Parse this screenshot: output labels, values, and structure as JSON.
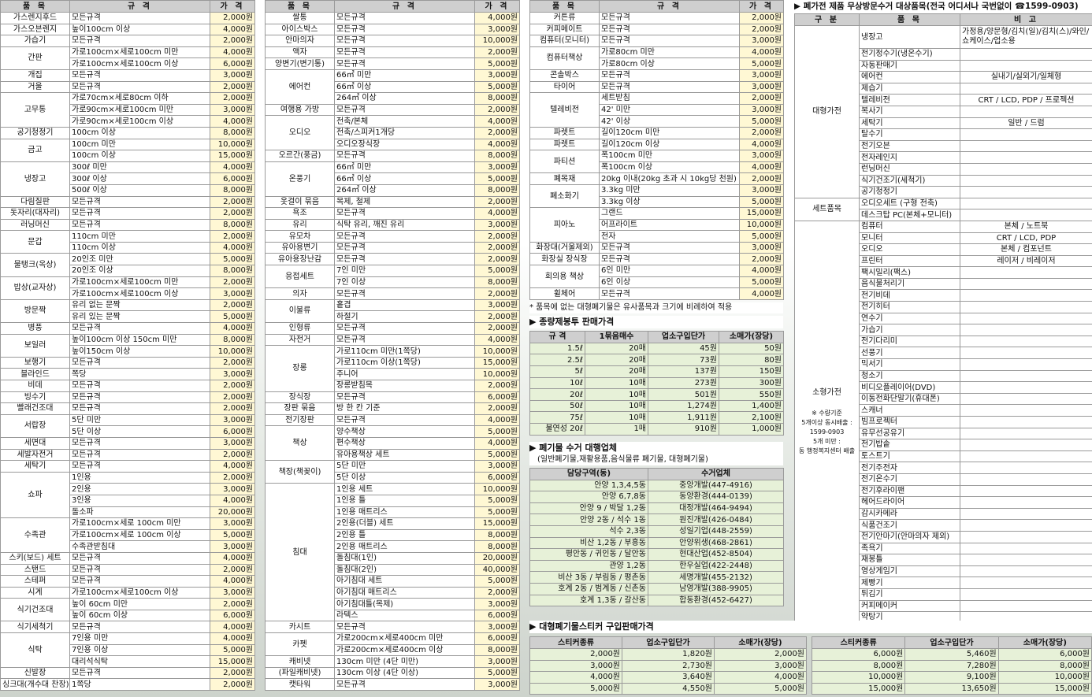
{
  "col1": {
    "headers": [
      "품 목",
      "규 격",
      "가 격"
    ],
    "rows": [
      [
        "가스렌지후드",
        "모든규격",
        "2,000원"
      ],
      [
        "가스오븐렌지",
        "높이100cm 이상",
        "4,000원"
      ],
      [
        "가습기",
        "모든규격",
        "2,000원"
      ],
      [
        "간판",
        "가로100cm×세로100cm 미만",
        "4,000원"
      ],
      [
        "",
        "가로100cm×세로100cm 이상",
        "6,000원"
      ],
      [
        "개집",
        "모든규격",
        "3,000원"
      ],
      [
        "거울",
        "모든규격",
        "2,000원"
      ],
      [
        "고무통",
        "가로70cm×세로80cm 이하",
        "2,000원"
      ],
      [
        "",
        "가로90cm×세로100cm 미만",
        "3,000원"
      ],
      [
        "",
        "가로90cm×세로100cm 이상",
        "4,000원"
      ],
      [
        "공기청정기",
        "100cm 이상",
        "8,000원"
      ],
      [
        "금고",
        "100cm 미만",
        "10,000원"
      ],
      [
        "",
        "100cm 이상",
        "15,000원"
      ],
      [
        "냉장고",
        "300ℓ 미만",
        "4,000원"
      ],
      [
        "",
        "300ℓ 이상",
        "6,000원"
      ],
      [
        "",
        "500ℓ 이상",
        "8,000원"
      ],
      [
        "다림질판",
        "모든규격",
        "2,000원"
      ],
      [
        "돗자리(대자리)",
        "모든규격",
        "2,000원"
      ],
      [
        "러닝머신",
        "모든규격",
        "8,000원"
      ],
      [
        "문갑",
        "110cm 미만",
        "2,000원"
      ],
      [
        "",
        "110cm 이상",
        "4,000원"
      ],
      [
        "물탱크(옥상)",
        "20인조 미만",
        "5,000원"
      ],
      [
        "",
        "20인조 이상",
        "8,000원"
      ],
      [
        "밥상(교자상)",
        "가로100cm×세로100cm 미만",
        "2,000원"
      ],
      [
        "",
        "가로100cm×세로100cm 이상",
        "3,000원"
      ],
      [
        "방문짝",
        "유리 없는 문짝",
        "2,000원"
      ],
      [
        "",
        "유리 있는 문짝",
        "5,000원"
      ],
      [
        "병풍",
        "모든규격",
        "4,000원"
      ],
      [
        "보일러",
        "높이100cm 이상 150cm 미만",
        "8,000원"
      ],
      [
        "",
        "높이150cm 이상",
        "10,000원"
      ],
      [
        "보행기",
        "모든규격",
        "2,000원"
      ],
      [
        "블라인드",
        "쪽당",
        "3,000원"
      ],
      [
        "비데",
        "모든규격",
        "2,000원"
      ],
      [
        "빙수기",
        "모든규격",
        "2,000원"
      ],
      [
        "빨래건조대",
        "모든규격",
        "2,000원"
      ],
      [
        "서랍장",
        "5단 미만",
        "3,000원"
      ],
      [
        "",
        "5단 이상",
        "6,000원"
      ],
      [
        "세면대",
        "모든규격",
        "3,000원"
      ],
      [
        "세발자전거",
        "모든규격",
        "2,000원"
      ],
      [
        "세탁기",
        "모든규격",
        "4,000원"
      ],
      [
        "쇼파",
        "1인용",
        "2,000원"
      ],
      [
        "",
        "2인용",
        "3,000원"
      ],
      [
        "",
        "3인용",
        "4,000원"
      ],
      [
        "",
        "돌소파",
        "20,000원"
      ],
      [
        "수족관",
        "가로100cm×세로 100cm 미만",
        "3,000원"
      ],
      [
        "",
        "가로100cm×세로 100cm 이상",
        "5,000원"
      ],
      [
        "",
        "수족관받침대",
        "3,000원"
      ],
      [
        "스키(보드) 세트",
        "모든규격",
        "4,000원"
      ],
      [
        "스탠드",
        "모든규격",
        "2,000원"
      ],
      [
        "스테퍼",
        "모든규격",
        "4,000원"
      ],
      [
        "시계",
        "가로100cm×세로100cm 이상",
        "3,000원"
      ],
      [
        "식기건조대",
        "높이 60cm 미만",
        "2,000원"
      ],
      [
        "",
        "높이 60cm 이상",
        "6,000원"
      ],
      [
        "식기세척기",
        "모든규격",
        "4,000원"
      ],
      [
        "식탁",
        "7인용 미만",
        "4,000원"
      ],
      [
        "",
        "7인용 이상",
        "5,000원"
      ],
      [
        "",
        "대리석식탁",
        "15,000원"
      ],
      [
        "신발장",
        "모든규격",
        "2,000원"
      ],
      [
        "싱크대(개수대 찬장)",
        "1쪽당",
        "2,000원"
      ]
    ]
  },
  "col2": {
    "headers": [
      "품 목",
      "규 격",
      "가 격"
    ],
    "rows": [
      [
        "쌀통",
        "모든규격",
        "4,000원"
      ],
      [
        "아이스박스",
        "모든규격",
        "3,000원"
      ],
      [
        "안마의자",
        "모든규격",
        "10,000원"
      ],
      [
        "액자",
        "모든규격",
        "2,000원"
      ],
      [
        "양변기(변기통)",
        "모든규격",
        "5,000원"
      ],
      [
        "에어컨",
        "66㎡ 미만",
        "3,000원"
      ],
      [
        "",
        "66㎡ 이상",
        "5,000원"
      ],
      [
        "",
        "264㎡ 이상",
        "8,000원"
      ],
      [
        "여행용 가방",
        "모든규격",
        "2,000원"
      ],
      [
        "오디오",
        "전축/본체",
        "4,000원"
      ],
      [
        "",
        "전축/스피커1개당",
        "2,000원"
      ],
      [
        "",
        "오디오장식장",
        "4,000원"
      ],
      [
        "오르간(풍금)",
        "모든규격",
        "8,000원"
      ],
      [
        "온풍기",
        "66㎡ 미만",
        "3,000원"
      ],
      [
        "",
        "66㎡ 이상",
        "5,000원"
      ],
      [
        "",
        "264㎡ 이상",
        "8,000원"
      ],
      [
        "옷걸이 묶음",
        "목제, 철제",
        "2,000원"
      ],
      [
        "욕조",
        "모든규격",
        "4,000원"
      ],
      [
        "유리",
        "식탁 유리, 깨진 유리",
        "3,000원"
      ],
      [
        "유모차",
        "모든규격",
        "2,000원"
      ],
      [
        "유아용변기",
        "모든규격",
        "2,000원"
      ],
      [
        "유아용장난감",
        "모든규격",
        "2,000원"
      ],
      [
        "응접세트",
        "7인 미만",
        "5,000원"
      ],
      [
        "",
        "7인 이상",
        "8,000원"
      ],
      [
        "의자",
        "모든규격",
        "2,000원"
      ],
      [
        "이불류",
        "홑겹",
        "3,000원"
      ],
      [
        "",
        "하절기",
        "2,000원"
      ],
      [
        "인형류",
        "모든규격",
        "2,000원"
      ],
      [
        "자전거",
        "모든규격",
        "4,000원"
      ],
      [
        "장롱",
        "가로110cm 미만(1쪽당)",
        "10,000원"
      ],
      [
        "",
        "가로110cm 이상(1쪽당)",
        "15,000원"
      ],
      [
        "",
        "주니어",
        "10,000원"
      ],
      [
        "",
        "장롱받침목",
        "2,000원"
      ],
      [
        "장식장",
        "모든규격",
        "6,000원"
      ],
      [
        "장판 묶음",
        "방 한 칸 기준",
        "2,000원"
      ],
      [
        "전기장판",
        "모든규격",
        "4,000원"
      ],
      [
        "책상",
        "양수책상",
        "5,000원"
      ],
      [
        "",
        "편수책상",
        "4,000원"
      ],
      [
        "",
        "유아용책상 세트",
        "5,000원"
      ],
      [
        "책장(책꽂이)",
        "5단 미만",
        "3,000원"
      ],
      [
        "",
        "5단 이상",
        "6,000원"
      ],
      [
        "침대",
        "1인용 세트",
        "10,000원"
      ],
      [
        "",
        "1인용 틀",
        "5,000원"
      ],
      [
        "",
        "1인용 매트리스",
        "5,000원"
      ],
      [
        "",
        "2인용(더블) 세트",
        "15,000원"
      ],
      [
        "",
        "2인용 틀",
        "8,000원"
      ],
      [
        "",
        "2인용 매트리스",
        "8,000원"
      ],
      [
        "",
        "돌침대(1인)",
        "20,000원"
      ],
      [
        "",
        "돌침대(2인)",
        "40,000원"
      ],
      [
        "",
        "아기침대 세트",
        "5,000원"
      ],
      [
        "",
        "아기침대 매트리스",
        "2,000원"
      ],
      [
        "",
        "아기침대틀(목제)",
        "3,000원"
      ],
      [
        "",
        "라텍스",
        "6,000원"
      ],
      [
        "카시트",
        "모든규격",
        "3,000원"
      ],
      [
        "카펫",
        "가로200cm×세로400cm 미만",
        "6,000원"
      ],
      [
        "",
        "가로200cm×세로400cm 이상",
        "8,000원"
      ],
      [
        "캐비넷",
        "130cm 미만 (4단 미만)",
        "3,000원"
      ],
      [
        "(파일캐비넷)",
        "130cm 이상 (4단 이상)",
        "5,000원"
      ],
      [
        "캣타워",
        "모든규격",
        "3,000원"
      ]
    ]
  },
  "col3": {
    "headers": [
      "품 목",
      "규 격",
      "가 격"
    ],
    "rows": [
      [
        "커튼류",
        "모든규격",
        "2,000원"
      ],
      [
        "커피메이트",
        "모든규격",
        "2,000원"
      ],
      [
        "컴퓨터(모니터)",
        "모든규격",
        "3,000원"
      ],
      [
        "컴퓨터책상",
        "가로80cm 미만",
        "4,000원"
      ],
      [
        "",
        "가로80cm 이상",
        "5,000원"
      ],
      [
        "콘솔박스",
        "모든규격",
        "3,000원"
      ],
      [
        "타이어",
        "모든규격",
        "3,000원"
      ],
      [
        "텔레비전",
        "세트받침",
        "2,000원"
      ],
      [
        "",
        "42' 미만",
        "3,000원"
      ],
      [
        "",
        "42' 이상",
        "5,000원"
      ],
      [
        "파렛트",
        "길이120cm 미만",
        "2,000원"
      ],
      [
        "파렛트",
        "길이120cm 이상",
        "4,000원"
      ],
      [
        "파티션",
        "폭100cm 미만",
        "3,000원"
      ],
      [
        "",
        "폭100cm 이상",
        "4,000원"
      ],
      [
        "폐목재",
        "20kg 이내(20kg 초과 시 10kg당 천원)",
        "2,000원"
      ],
      [
        "폐소화기",
        "3.3kg 미만",
        "3,000원"
      ],
      [
        "",
        "3.3kg 이상",
        "5,000원"
      ],
      [
        "피아노",
        "그랜드",
        "15,000원"
      ],
      [
        "",
        "어프라이트",
        "10,000원"
      ],
      [
        "",
        "전자",
        "5,000원"
      ],
      [
        "화장대(거울제외)",
        "모든규격",
        "3,000원"
      ],
      [
        "화장실 장식장",
        "모든규격",
        "2,000원"
      ],
      [
        "회의용 책상",
        "6인 미만",
        "4,000원"
      ],
      [
        "",
        "6인 이상",
        "5,000원"
      ],
      [
        "휠체어",
        "모든규격",
        "4,000원"
      ]
    ],
    "note": "* 품목에 없는 대형폐기물은 유사품목과 크기에 비례하여 적용",
    "bag_title": "▶ 종량제봉투 판매가격",
    "bag_headers": [
      "규 격",
      "1묶음매수",
      "업소구입단가",
      "소매가(장당)"
    ],
    "bag_rows": [
      [
        "1.5ℓ",
        "20매",
        "45원",
        "50원"
      ],
      [
        "2.5ℓ",
        "20매",
        "73원",
        "80원"
      ],
      [
        "5ℓ",
        "20매",
        "137원",
        "150원"
      ],
      [
        "10ℓ",
        "10매",
        "273원",
        "300원"
      ],
      [
        "20ℓ",
        "10매",
        "501원",
        "550원"
      ],
      [
        "50ℓ",
        "10매",
        "1,274원",
        "1,400원"
      ],
      [
        "75ℓ",
        "10매",
        "1,911원",
        "2,100원"
      ],
      [
        "불연성 20ℓ",
        "1매",
        "910원",
        "1,000원"
      ]
    ],
    "agency_title": "▶ 폐기물 수거 대행업체",
    "agency_sub": "(일반폐기물,재활용품,음식물류 폐기물, 대형폐기물)",
    "agency_headers": [
      "담당구역(동)",
      "수거업체"
    ],
    "agency_rows": [
      [
        "안양 1,3,4,5동",
        "중앙개발(447-4916)"
      ],
      [
        "안양 6,7,8동",
        "동양환경(444-0139)"
      ],
      [
        "안양 9 / 박달 1,2동",
        "대정개발(464-9494)"
      ],
      [
        "안양 2동 / 석수 1동",
        "원진개발(426-0484)"
      ],
      [
        "석수 2,3동",
        "성일기업(448-2559)"
      ],
      [
        "비산 1,2동 / 부흥동",
        "안양위생(468-2861)"
      ],
      [
        "평안동 / 귀인동 / 달안동",
        "현대산업(452-8504)"
      ],
      [
        "관양 1,2동",
        "한우실업(422-2448)"
      ],
      [
        "비산 3동 / 부림동 / 평촌동",
        "세명개발(455-2132)"
      ],
      [
        "호계 2동 / 범계동 / 신촌동",
        "남영개발(388-9905)"
      ],
      [
        "호계 1,3동 / 갈산동",
        "합동환경(452-6427)"
      ]
    ]
  },
  "col4": {
    "title": "▶ 폐가전 제품 무상방문수거 대상품목(전국 어디서나 국번없이 ☎1599-0903)",
    "headers": [
      "구 분",
      "품 목",
      "비 고"
    ],
    "big_label": "대형가전",
    "big": [
      [
        "냉장고",
        "가정용/양문형/김치(일)/김치(스)/와인/쇼케이스/업소용"
      ],
      [
        "전기정수기(냉온수기)",
        ""
      ],
      [
        "자동판매기",
        ""
      ],
      [
        "에어컨",
        "실내기/실외기/일체형"
      ],
      [
        "제습기",
        ""
      ],
      [
        "텔레비전",
        "CRT / LCD, PDP / 프로젝션"
      ],
      [
        "복사기",
        ""
      ],
      [
        "세탁기",
        "일반 / 드럼"
      ],
      [
        "탈수기",
        ""
      ],
      [
        "전기오븐",
        ""
      ],
      [
        "전자레인지",
        ""
      ],
      [
        "런닝머신",
        ""
      ],
      [
        "식기건조기(세척기)",
        ""
      ],
      [
        "공기청정기",
        ""
      ]
    ],
    "set_label": "세트품목",
    "set": [
      [
        "오디오세트 (구형 전축)",
        ""
      ],
      [
        "데스크탑 PC(본체+모니터)",
        ""
      ]
    ],
    "small_label": "소형가전",
    "small_note1": "※ 수량기준",
    "small_note2": "5개이상 동시배출 :",
    "small_note3": "1599-0903",
    "small_note4": "5개 미만 :",
    "small_note5": "동 행정복지센터 배출",
    "small": [
      [
        "컴퓨터",
        "본체 / 노트북"
      ],
      [
        "모니터",
        "CRT / LCD, PDP"
      ],
      [
        "오디오",
        "본체 / 컴포넌트"
      ],
      [
        "프린터",
        "레이저 / 비레이저"
      ],
      [
        "팩시밀리(팩스)",
        ""
      ],
      [
        "음식물처리기",
        ""
      ],
      [
        "전기비데",
        ""
      ],
      [
        "전기히터",
        ""
      ],
      [
        "연수기",
        ""
      ],
      [
        "가습기",
        ""
      ],
      [
        "전기다리미",
        ""
      ],
      [
        "선풍기",
        ""
      ],
      [
        "믹서기",
        ""
      ],
      [
        "청소기",
        ""
      ],
      [
        "비디오플레이어(DVD)",
        ""
      ],
      [
        "이동전화단말기(휴대폰)",
        ""
      ],
      [
        "스캐너",
        ""
      ],
      [
        "빔프로젝터",
        ""
      ],
      [
        "유무선공유기",
        ""
      ],
      [
        "전기밥솥",
        ""
      ],
      [
        "토스트기",
        ""
      ],
      [
        "전기주전자",
        ""
      ],
      [
        "전기온수기",
        ""
      ],
      [
        "전기후라이팬",
        ""
      ],
      [
        "헤어드라이어",
        ""
      ],
      [
        "감시카메라",
        ""
      ],
      [
        "식품건조기",
        ""
      ],
      [
        "전기안마기(안마의자 제외)",
        ""
      ],
      [
        "족욕기",
        ""
      ],
      [
        "재봉틀",
        ""
      ],
      [
        "영상게임기",
        ""
      ],
      [
        "제빵기",
        ""
      ],
      [
        "튀김기",
        ""
      ],
      [
        "커피메이커",
        ""
      ],
      [
        "약탕기",
        ""
      ]
    ]
  },
  "sticker": {
    "title": "▶ 대형폐기물스티커 구입판매가격",
    "headers": [
      "스티커종류",
      "업소구입단가",
      "소매가(장당)"
    ],
    "left": [
      [
        "2,000원",
        "1,820원",
        "2,000원"
      ],
      [
        "3,000원",
        "2,730원",
        "3,000원"
      ],
      [
        "4,000원",
        "3,640원",
        "4,000원"
      ],
      [
        "5,000원",
        "4,550원",
        "5,000원"
      ]
    ],
    "right": [
      [
        "6,000원",
        "5,460원",
        "6,000원"
      ],
      [
        "8,000원",
        "7,280원",
        "8,000원"
      ],
      [
        "10,000원",
        "9,100원",
        "10,000원"
      ],
      [
        "15,000원",
        "13,650원",
        "15,000원"
      ]
    ]
  }
}
